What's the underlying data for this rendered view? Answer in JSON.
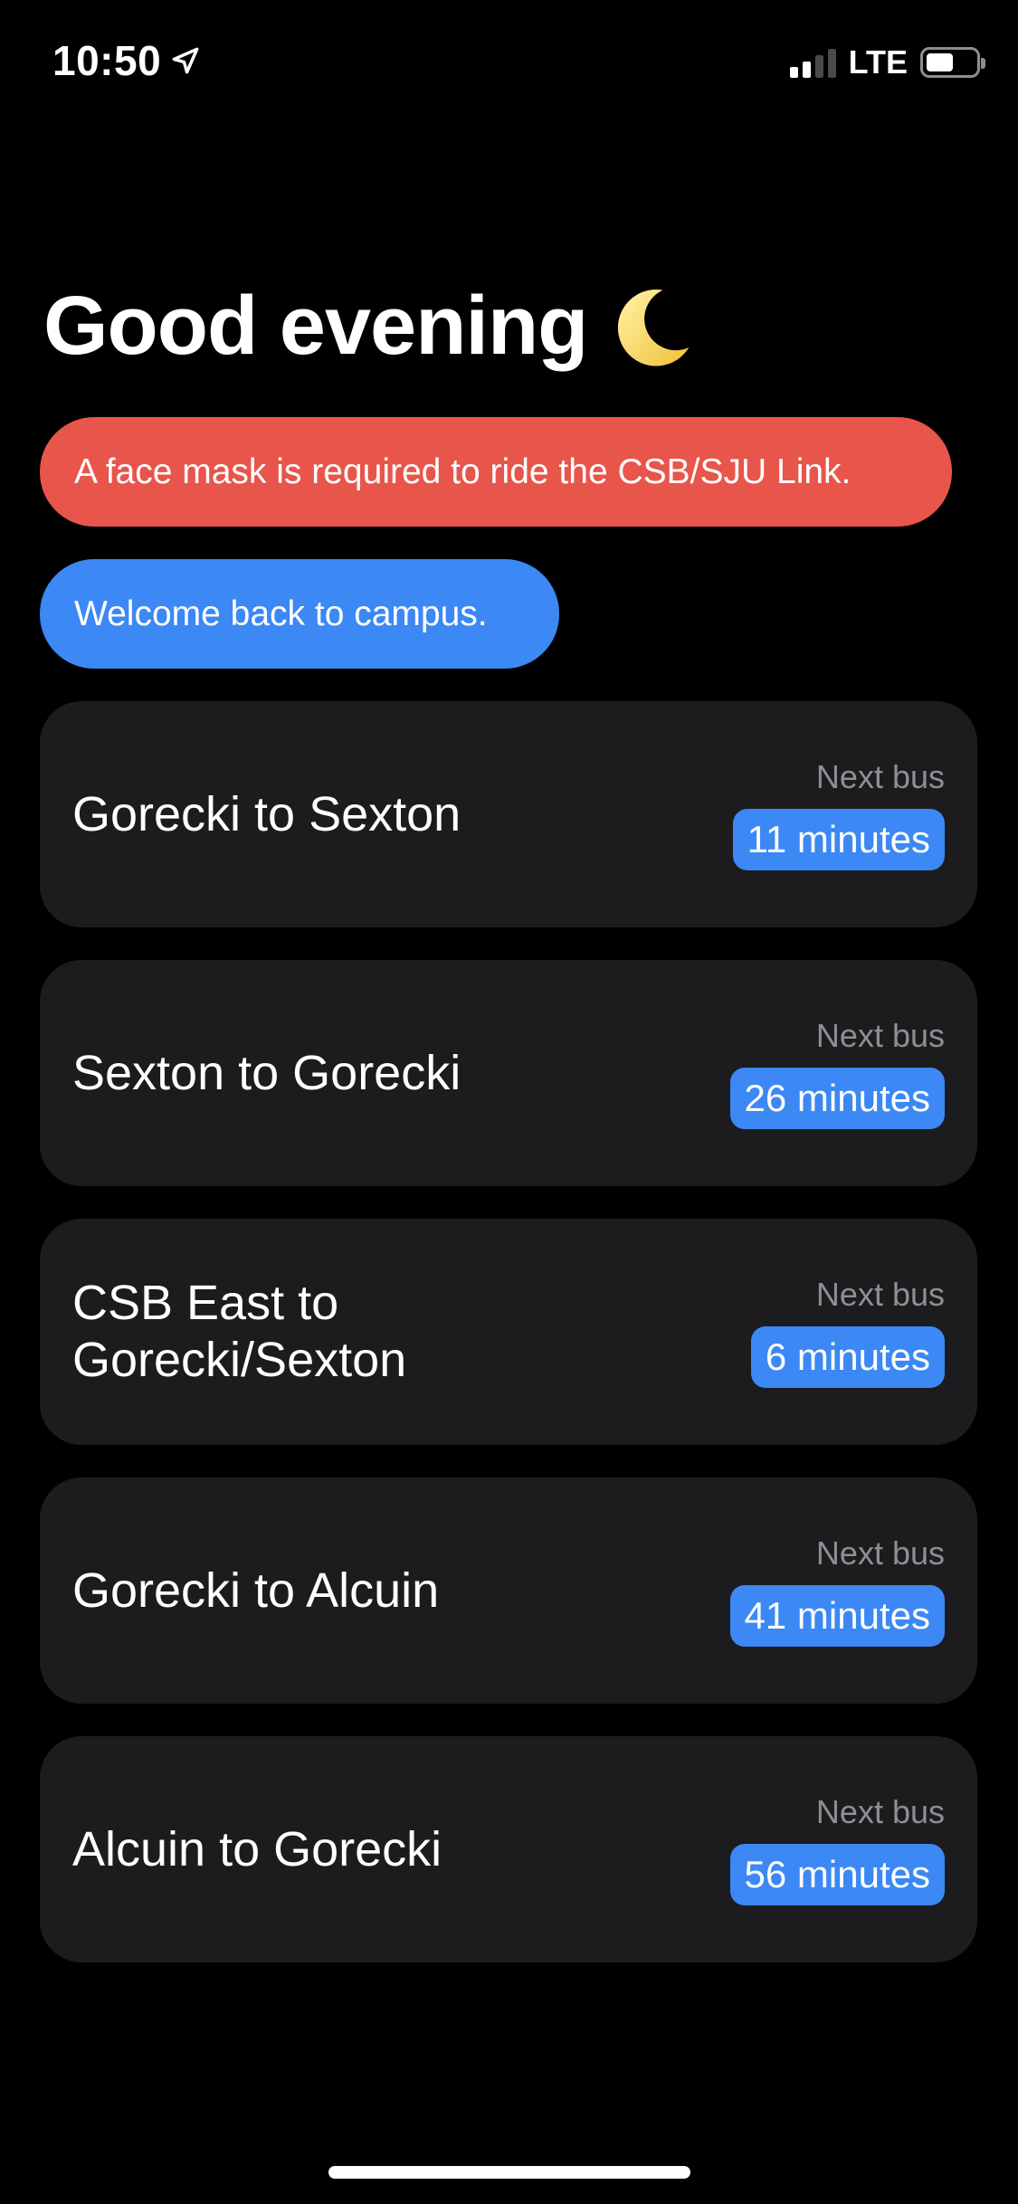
{
  "status_bar": {
    "time": "10:50",
    "location_icon": "location-arrow-icon",
    "network": "LTE",
    "signal_icon": "cellular-signal-icon",
    "battery_icon": "battery-icon",
    "battery_level": 0.55
  },
  "greeting": {
    "title": "Good evening",
    "icon": "crescent-moon-icon"
  },
  "alerts": {
    "mask_notice": "A face mask is required to ride the CSB/SJU Link.",
    "welcome_notice": "Welcome back to campus."
  },
  "routes": [
    {
      "name": "Gorecki to Sexton",
      "next_label": "Next bus",
      "minutes": "11 minutes"
    },
    {
      "name": "Sexton to Gorecki",
      "next_label": "Next bus",
      "minutes": "26 minutes"
    },
    {
      "name": "CSB East to Gorecki/Sexton",
      "next_label": "Next bus",
      "minutes": "6 minutes"
    },
    {
      "name": "Gorecki to Alcuin",
      "next_label": "Next bus",
      "minutes": "41 minutes"
    },
    {
      "name": "Alcuin to Gorecki",
      "next_label": "Next bus",
      "minutes": "56 minutes"
    }
  ],
  "colors": {
    "background": "#000000",
    "card": "#1c1c1e",
    "alert_red": "#e8554b",
    "accent_blue": "#3c88f4",
    "secondary_text": "#8e8e93"
  }
}
